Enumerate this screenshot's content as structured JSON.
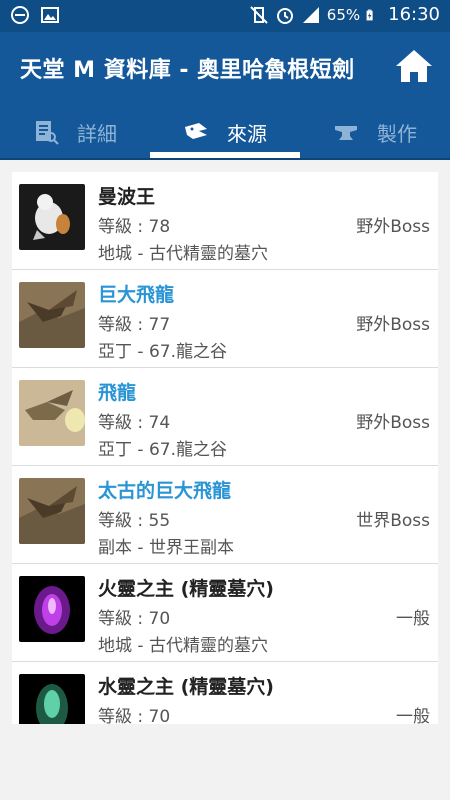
{
  "status_bar": {
    "battery_percent": "65%",
    "time": "16:30",
    "icons": [
      "dnd-minus-icon",
      "image-icon",
      "mute-vibrate-icon",
      "alarm-icon",
      "signal-icon",
      "battery-charging-icon"
    ]
  },
  "app_bar": {
    "title": "天堂 M 資料庫 - 奧里哈魯根短劍",
    "home_icon": "home-icon"
  },
  "tabs": [
    {
      "label": "詳細",
      "icon": "document-search-icon",
      "selected": false
    },
    {
      "label": "來源",
      "icon": "monster-head-icon",
      "selected": true
    },
    {
      "label": "製作",
      "icon": "anvil-icon",
      "selected": false
    }
  ],
  "colors": {
    "appbar": "#14589a",
    "statusbar": "#0f4d86",
    "link": "#2a95d6"
  },
  "sources": [
    {
      "name": "曼波王",
      "level": "等級 : 78",
      "type": "野外Boss",
      "location": "地城 - 古代精靈的墓穴",
      "link": false
    },
    {
      "name": "巨大飛龍",
      "level": "等級 : 77",
      "type": "野外Boss",
      "location": "亞丁 - 67.龍之谷",
      "link": true
    },
    {
      "name": "飛龍",
      "level": "等級 : 74",
      "type": "野外Boss",
      "location": "亞丁 - 67.龍之谷",
      "link": true
    },
    {
      "name": "太古的巨大飛龍",
      "level": "等級 : 55",
      "type": "世界Boss",
      "location": "副本 - 世界王副本",
      "link": true
    },
    {
      "name": "火靈之主 (精靈墓穴)",
      "level": "等級 : 70",
      "type": "一般",
      "location": "地城 - 古代精靈的墓穴",
      "link": false
    },
    {
      "name": "水靈之主 (精靈墓穴)",
      "level": "等級 : 70",
      "type": "一般",
      "location": "",
      "link": false
    }
  ]
}
